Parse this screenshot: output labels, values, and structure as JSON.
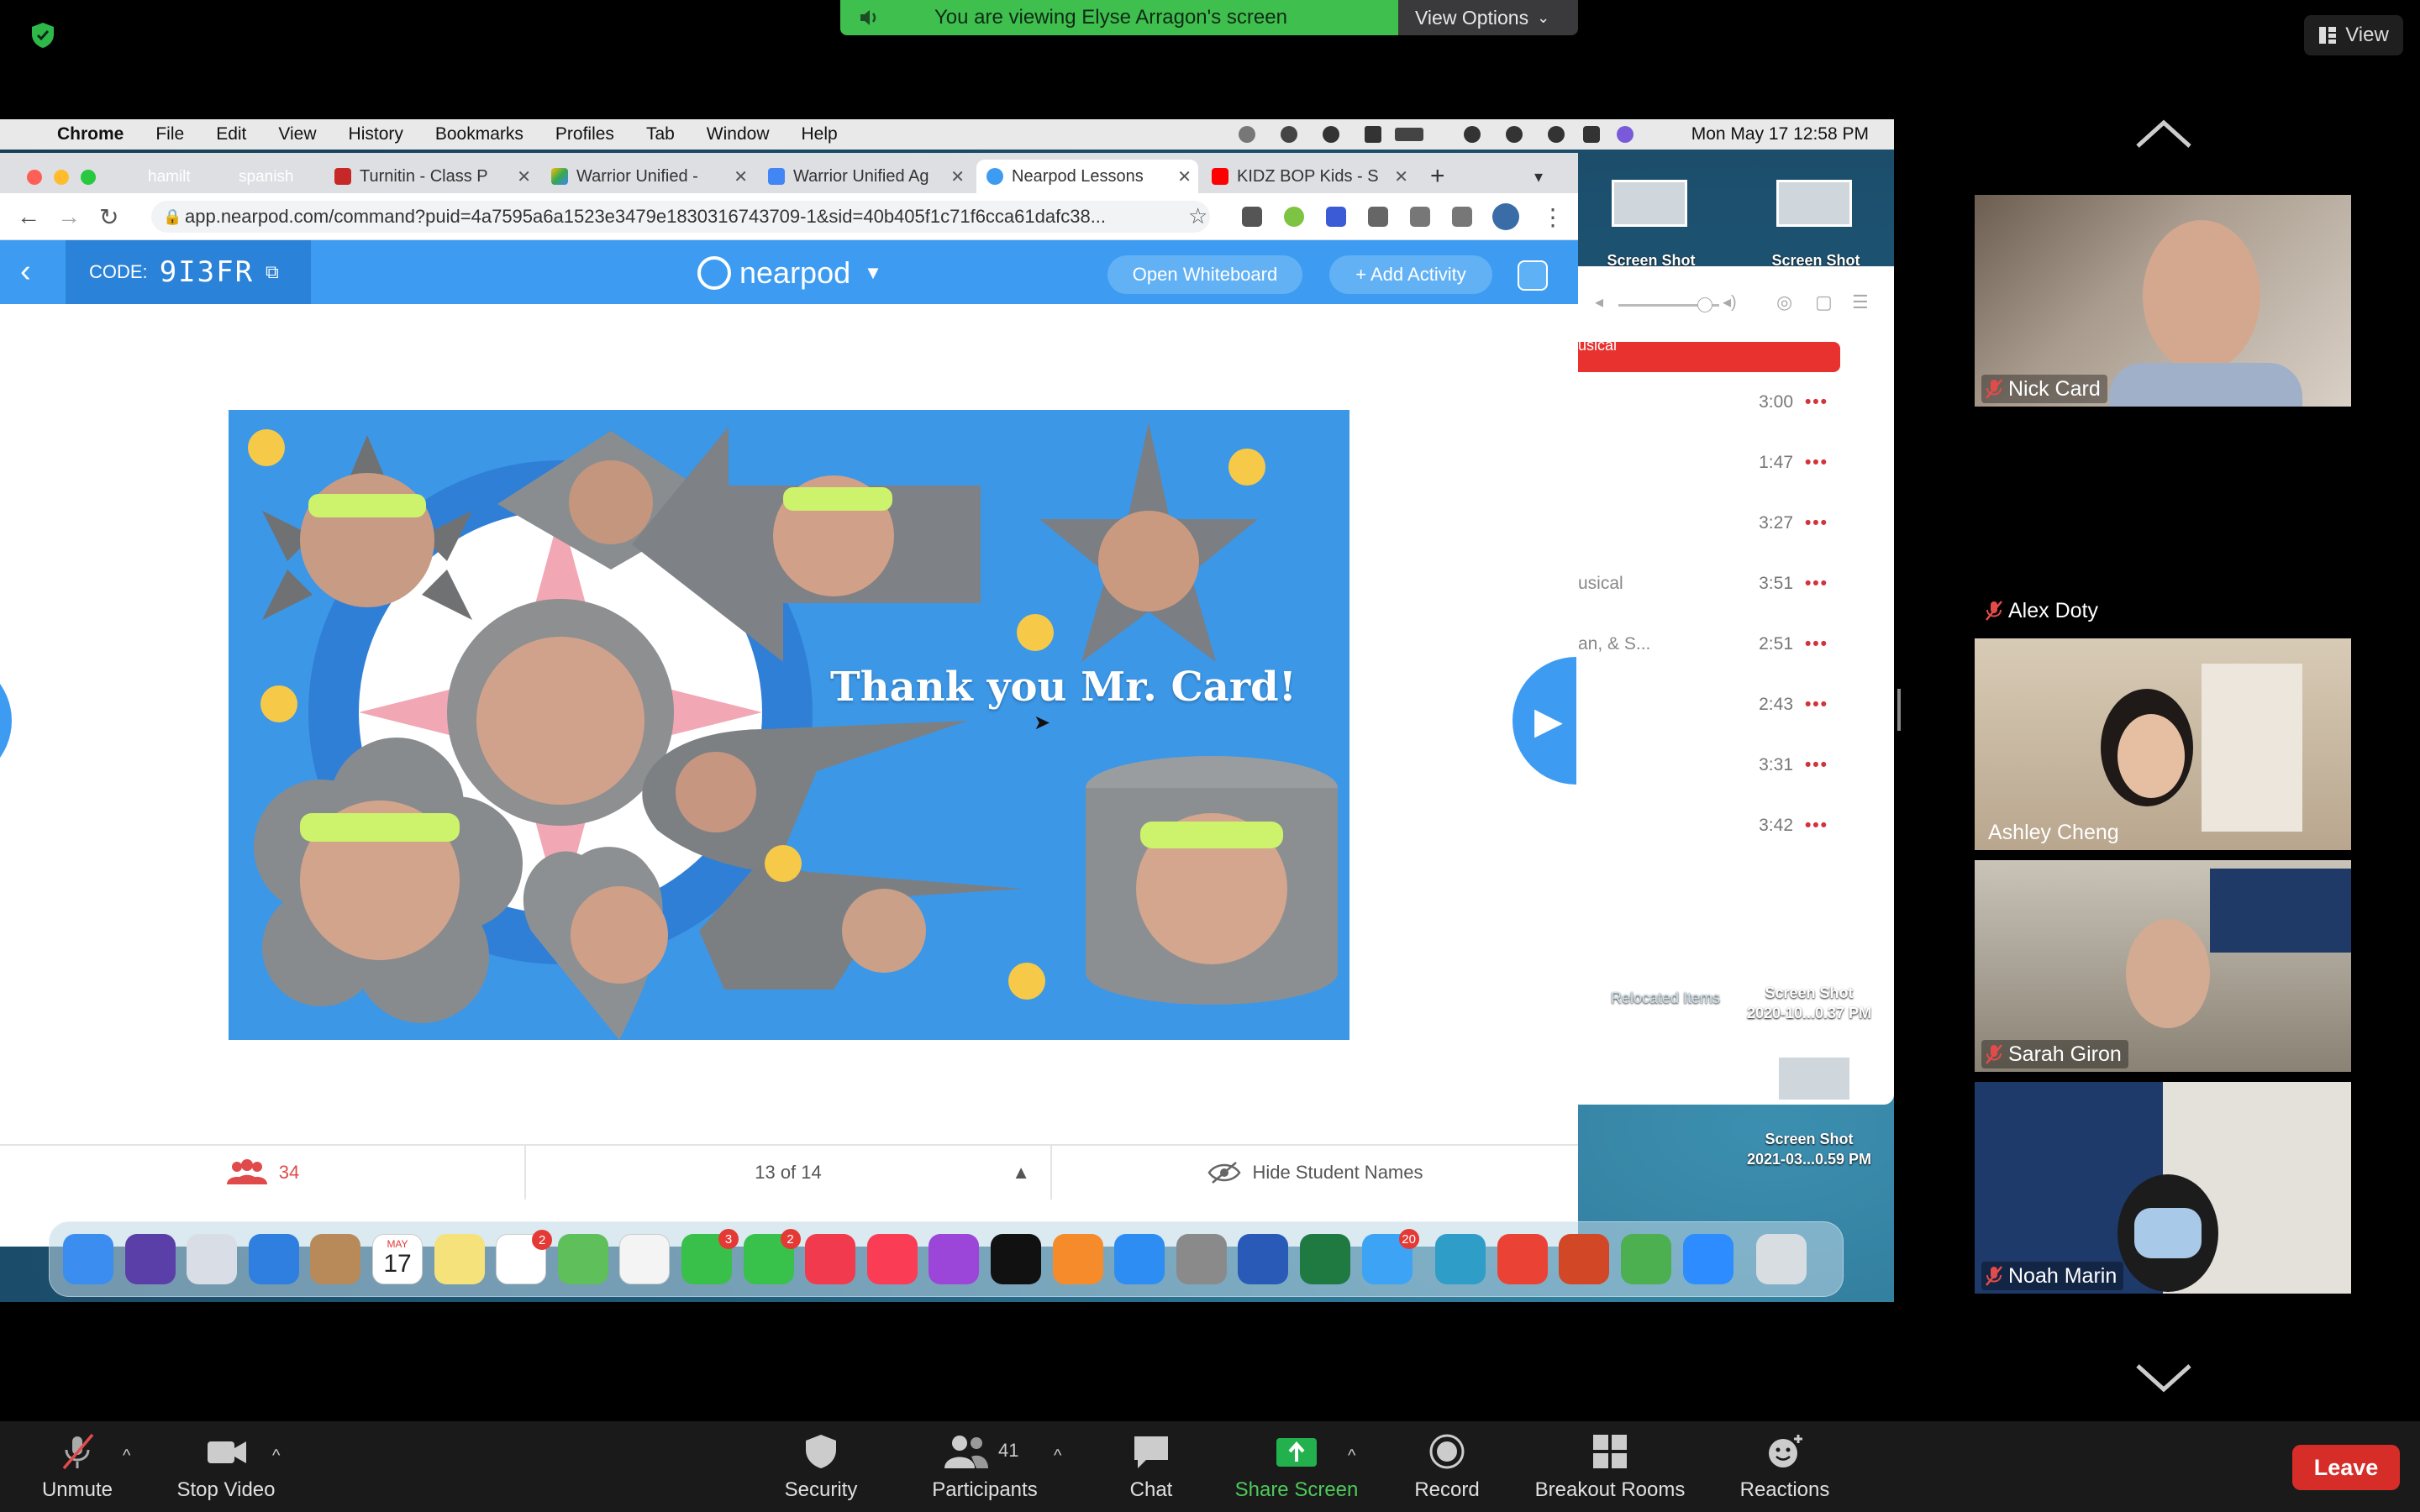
{
  "banner": {
    "viewing_text": "You are viewing Elyse Arragon's screen",
    "view_options": "View Options"
  },
  "top_right": {
    "view_label": "View"
  },
  "menubar": {
    "app": "Chrome",
    "items": [
      "File",
      "Edit",
      "View",
      "History",
      "Bookmarks",
      "Profiles",
      "Tab",
      "Window",
      "Help"
    ],
    "clock": "Mon May 17  12:58 PM"
  },
  "chrome": {
    "tab_groups": [
      {
        "label": "hamilt",
        "color": "#d32f8a"
      },
      {
        "label": "spanish",
        "color": "#1e8e5e"
      }
    ],
    "tabs": [
      {
        "label": "Turnitin - Class P"
      },
      {
        "label": "Warrior Unified -"
      },
      {
        "label": "Warrior Unified Ag"
      },
      {
        "label": "Nearpod Lessons"
      },
      {
        "label": "KIDZ BOP Kids - S"
      }
    ],
    "url": "app.nearpod.com/command?puid=4a7595a6a1523e3479e1830316743709-1&sid=40b405f1c71f6cca61dafc38..."
  },
  "nearpod": {
    "code_label": "CODE:",
    "code_value": "9I3FR",
    "logo": "nearpod",
    "open_whiteboard": "Open Whiteboard",
    "add_activity": "+ Add Activity",
    "slide_title": "Thank you Mr. Card!",
    "student_count": "34",
    "page_indicator": "13 of 14",
    "hide_names": "Hide Student Names"
  },
  "music": {
    "rows": [
      {
        "name": "",
        "time": "3:00"
      },
      {
        "name": "",
        "time": "1:47"
      },
      {
        "name": "",
        "time": "3:27"
      },
      {
        "name": "usical",
        "time": "3:51"
      },
      {
        "name": "an, & S...",
        "time": "2:51"
      },
      {
        "name": "",
        "time": "2:43"
      },
      {
        "name": "",
        "time": "3:31"
      },
      {
        "name": "",
        "time": "3:42"
      }
    ],
    "more_label": "•••",
    "partial_red_label": "usical"
  },
  "desktop": {
    "screenshot_label": "Screen Shot",
    "relocated": "Relocated Items",
    "shot1_name": "Screen Shot",
    "shot1_date": "2020-10...0.37 PM",
    "shot2_name": "Screen Shot",
    "shot2_date": "2021-03...0.59 PM"
  },
  "dock": {
    "icons": [
      {
        "name": "finder",
        "color": "#3b8ef0"
      },
      {
        "name": "siri",
        "color": "#5b3fa8"
      },
      {
        "name": "launchpad",
        "color": "#d9dde6"
      },
      {
        "name": "safari",
        "color": "#2f7fe0"
      },
      {
        "name": "contacts",
        "color": "#b88a5a"
      },
      {
        "name": "calendar",
        "color": "#ffffff"
      },
      {
        "name": "notes",
        "color": "#f6e27a"
      },
      {
        "name": "reminders",
        "color": "#ffffff"
      },
      {
        "name": "maps",
        "color": "#5fbf5a"
      },
      {
        "name": "photos",
        "color": "#f4f4f4"
      },
      {
        "name": "messages",
        "color": "#39c04a"
      },
      {
        "name": "facetime",
        "color": "#38c24c"
      },
      {
        "name": "news",
        "color": "#f23a4e"
      },
      {
        "name": "music",
        "color": "#fa3c54"
      },
      {
        "name": "podcasts",
        "color": "#9b46d9"
      },
      {
        "name": "tv",
        "color": "#111111"
      },
      {
        "name": "books",
        "color": "#f58b2a"
      },
      {
        "name": "app-store",
        "color": "#2e8df2"
      },
      {
        "name": "system-preferences",
        "color": "#8a8a8a"
      },
      {
        "name": "word",
        "color": "#2a5ab8"
      },
      {
        "name": "excel",
        "color": "#1f7a42"
      },
      {
        "name": "mail",
        "color": "#3da3f5"
      },
      {
        "name": "screen-recorder",
        "color": "#2e9ec8"
      },
      {
        "name": "chrome",
        "color": "#ea4335"
      },
      {
        "name": "powerpoint",
        "color": "#d24726"
      },
      {
        "name": "vectorworks",
        "color": "#4caf50"
      },
      {
        "name": "zoom",
        "color": "#2d8cff"
      },
      {
        "name": "trash",
        "color": "#d8dde2"
      }
    ],
    "badges": {
      "reminders": "2",
      "messages": "3",
      "facetime": "2",
      "mail": "20"
    },
    "calendar_month": "MAY",
    "calendar_day": "17"
  },
  "participants": [
    {
      "name": "Nick Card",
      "muted": true
    },
    {
      "name": "Alex Doty",
      "muted": true
    },
    {
      "name": "Ashley Cheng",
      "muted": false
    },
    {
      "name": "Sarah Giron",
      "muted": true
    },
    {
      "name": "Noah Marin",
      "muted": true
    }
  ],
  "toolbar": {
    "unmute": "Unmute",
    "stop_video": "Stop Video",
    "security": "Security",
    "participants": "Participants",
    "participant_count": "41",
    "chat": "Chat",
    "share_screen": "Share Screen",
    "record": "Record",
    "breakout": "Breakout Rooms",
    "reactions": "Reactions",
    "leave": "Leave"
  },
  "colors": {
    "zoom_green": "#3fbf4e",
    "nearpod_blue": "#3d9cf2",
    "leave_red": "#d62d29",
    "share_green": "#22b14c",
    "share_label": "#4ec95a"
  }
}
